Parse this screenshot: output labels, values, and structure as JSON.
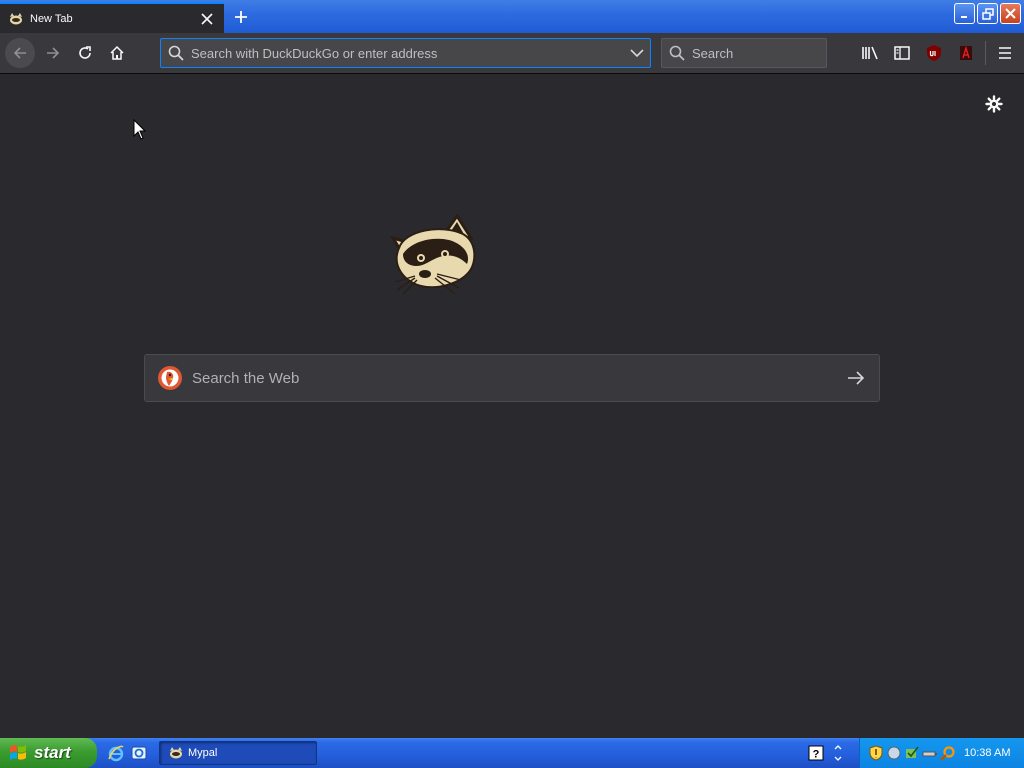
{
  "browser": {
    "tab": {
      "title": "New Tab"
    },
    "urlbar": {
      "placeholder": "Search with DuckDuckGo or enter address"
    },
    "searchbar": {
      "placeholder": "Search"
    }
  },
  "content": {
    "web_search": {
      "placeholder": "Search the Web"
    }
  },
  "taskbar": {
    "start_label": "start",
    "task_label": "Mypal",
    "clock": "10:38 AM"
  },
  "colors": {
    "accent": "#0a84ff",
    "toolbar": "#38383d",
    "content_bg": "#2a2a2e",
    "start_green": "#3b9c30",
    "taskbar_blue": "#245edb"
  },
  "icons": [
    "mypal-favicon",
    "close-icon",
    "plus-icon",
    "minimize-icon",
    "maximize-icon",
    "back-arrow-icon",
    "forward-arrow-icon",
    "reload-icon",
    "home-icon",
    "search-icon",
    "chevron-down-icon",
    "library-icon",
    "sidebar-icon",
    "ublock-icon",
    "extension-icon",
    "hamburger-menu-icon",
    "gear-icon",
    "raccoon-logo-icon",
    "duckduckgo-icon",
    "arrow-right-icon",
    "windows-flag-icon",
    "ie-icon",
    "show-desktop-icon",
    "help-icon",
    "shield-icon",
    "clock-tray-icon"
  ]
}
